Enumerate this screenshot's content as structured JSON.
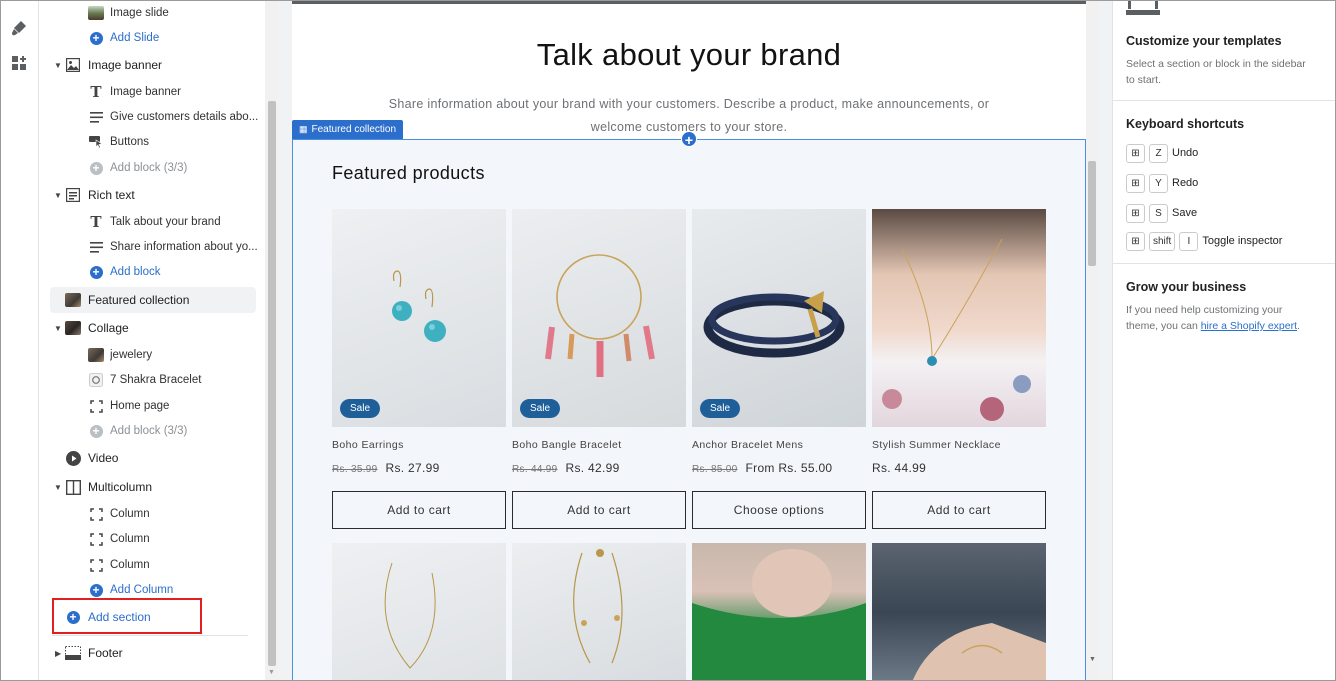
{
  "sidebar": {
    "image_slide": "Image slide",
    "add_slide": "Add Slide",
    "image_banner": {
      "label": "Image banner",
      "blocks": [
        "Image banner",
        "Give customers details abo...",
        "Buttons"
      ],
      "add_block": "Add block (3/3)"
    },
    "rich_text": {
      "label": "Rich text",
      "blocks": [
        "Talk about your brand",
        "Share information about yo..."
      ],
      "add_block": "Add block"
    },
    "featured_collection": "Featured collection",
    "collage": {
      "label": "Collage",
      "blocks": [
        "jewelery",
        "7 Shakra Bracelet",
        "Home page"
      ],
      "add_block": "Add block (3/3)"
    },
    "video": "Video",
    "multicolumn": {
      "label": "Multicolumn",
      "blocks": [
        "Column",
        "Column",
        "Column"
      ],
      "add_column": "Add Column"
    },
    "add_section": "Add section",
    "footer": "Footer"
  },
  "preview": {
    "brand_title": "Talk about your brand",
    "brand_text": "Share information about your brand with your customers. Describe a product, make announcements, or welcome customers to your store.",
    "section_tag": "Featured collection",
    "featured_heading": "Featured products",
    "sale_label": "Sale",
    "products": [
      {
        "name": "Boho Earrings",
        "old_price": "Rs. 35.99",
        "price": "Rs. 27.99",
        "sale": true,
        "button": "Add to cart"
      },
      {
        "name": "Boho Bangle Bracelet",
        "old_price": "Rs. 44.99",
        "price": "Rs. 42.99",
        "sale": true,
        "button": "Add to cart"
      },
      {
        "name": "Anchor Bracelet Mens",
        "old_price": "Rs. 85.00",
        "price": "From Rs. 55.00",
        "sale": true,
        "button": "Choose options"
      },
      {
        "name": "Stylish Summer Necklace",
        "old_price": "",
        "price": "Rs. 44.99",
        "sale": false,
        "button": "Add to cart"
      }
    ]
  },
  "right_panel": {
    "customize_title": "Customize your templates",
    "customize_text": "Select a section or block in the sidebar to start.",
    "shortcuts_title": "Keyboard shortcuts",
    "shortcuts": [
      {
        "keys": [
          "Z"
        ],
        "label": "Undo"
      },
      {
        "keys": [
          "Y"
        ],
        "label": "Redo"
      },
      {
        "keys": [
          "S"
        ],
        "label": "Save"
      },
      {
        "keys": [
          "shift",
          "I"
        ],
        "label": "Toggle inspector"
      }
    ],
    "grow_title": "Grow your business",
    "grow_text_before": "If you need help customizing your theme, you can ",
    "grow_link": "hire a Shopify expert",
    "grow_text_after": "."
  },
  "colors": {
    "accent": "#2c6ecb",
    "sale_badge": "#1f5f99",
    "highlight": "#e02020",
    "selection_outline": "#4a8fe0"
  }
}
